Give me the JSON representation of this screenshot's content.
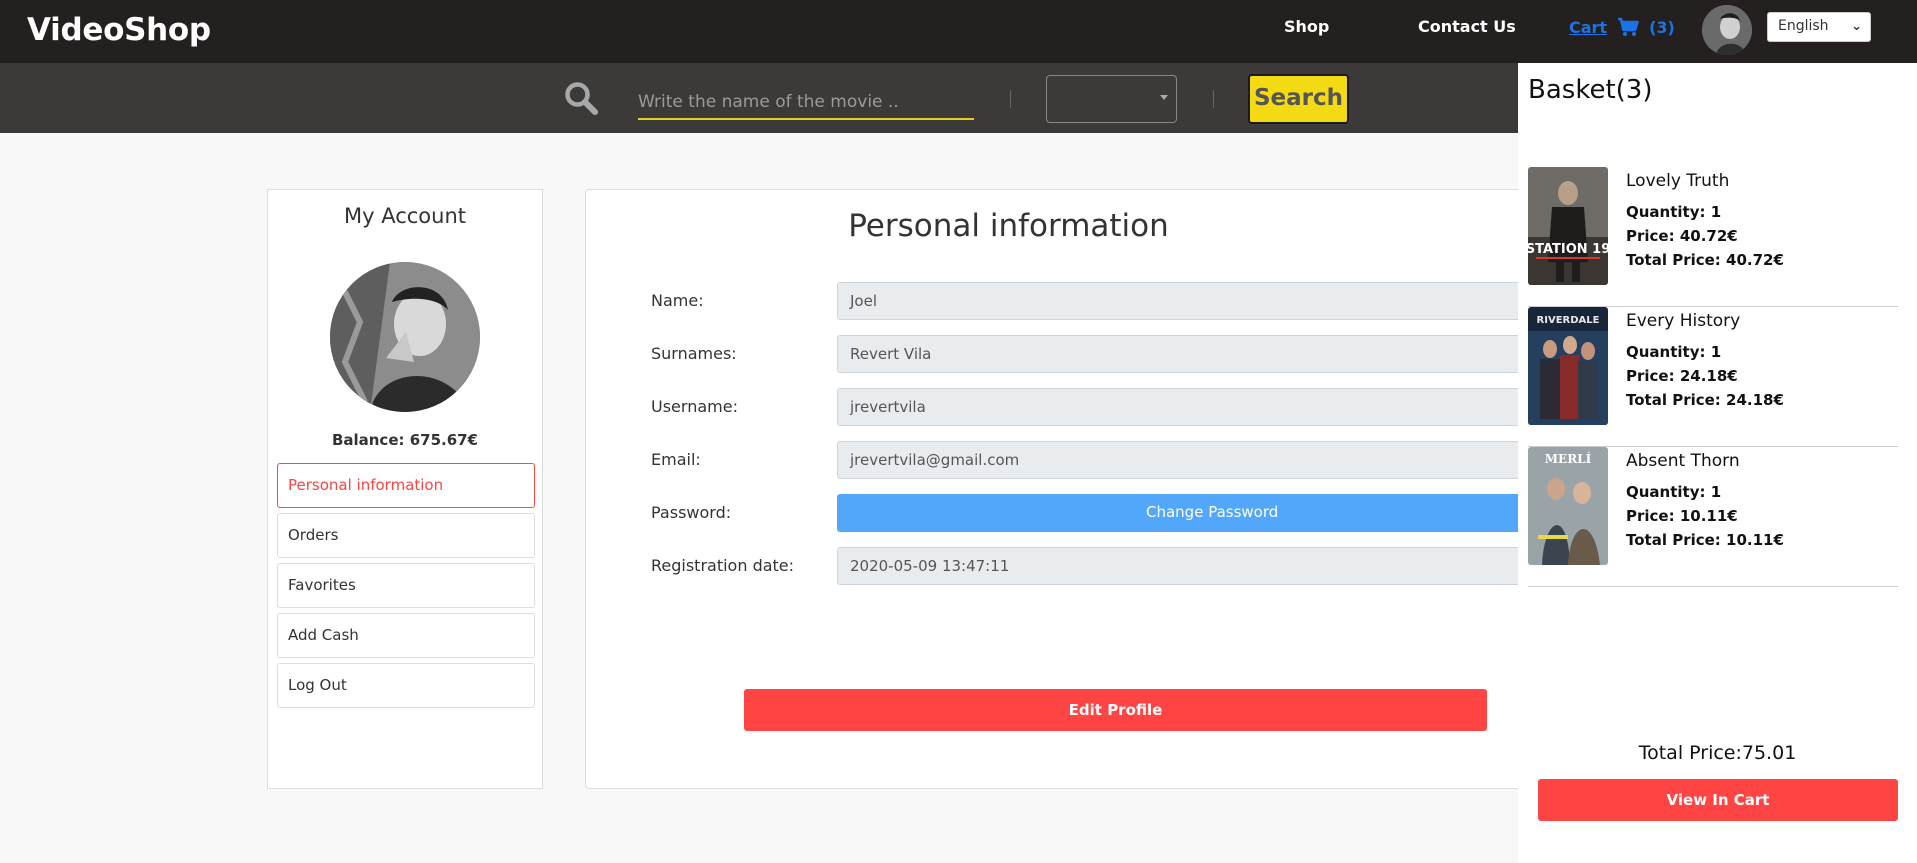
{
  "navbar": {
    "brand": "VideoShop",
    "shop_label": "Shop",
    "contact_label": "Contact Us",
    "cart_label": "Cart",
    "cart_count": "(3)",
    "language": "English",
    "icons": {
      "cart": "shopping-cart-icon",
      "avatar": "user-avatar"
    }
  },
  "search": {
    "placeholder": "Write the name of the movie ..",
    "value": "",
    "genre_selected": "",
    "button_label": "Search",
    "accent_color": "#f3da12"
  },
  "account": {
    "title": "My Account",
    "balance": "Balance: 675.67€",
    "menu": [
      {
        "label": "Personal information",
        "active": true
      },
      {
        "label": "Orders",
        "active": false
      },
      {
        "label": "Favorites",
        "active": false
      },
      {
        "label": "Add Cash",
        "active": false
      },
      {
        "label": "Log Out",
        "active": false
      }
    ]
  },
  "personal_info": {
    "title": "Personal information",
    "fields": [
      {
        "label": "Name:",
        "value": "Joel"
      },
      {
        "label": "Surnames:",
        "value": "Revert Vila"
      },
      {
        "label": "Username:",
        "value": "jrevertvila"
      },
      {
        "label": "Email:",
        "value": "jrevertvila@gmail.com"
      },
      {
        "label": "Password:",
        "button": "Change Password"
      },
      {
        "label": "Registration date:",
        "value": "2020-05-09 13:47:11"
      }
    ],
    "edit_button": "Edit Profile"
  },
  "basket": {
    "title": "Basket(3)",
    "items": [
      {
        "name": "Lovely Truth",
        "quantity": "Quantity: 1",
        "price": "Price: 40.72€",
        "total": "Total Price: 40.72€",
        "poster_text": "STATION 19"
      },
      {
        "name": "Every History",
        "quantity": "Quantity: 1",
        "price": "Price: 24.18€",
        "total": "Total Price: 24.18€",
        "poster_text": "RIVERDALE"
      },
      {
        "name": "Absent Thorn",
        "quantity": "Quantity: 1",
        "price": "Price: 10.11€",
        "total": "Total Price: 10.11€",
        "poster_text": "MERLÍ"
      }
    ],
    "total": "Total Price:75.01",
    "view_button": "View In Cart"
  },
  "colors": {
    "navbar_bg": "#24201f",
    "searchbar_bg": "#3c3a38",
    "primary_red": "#ff4444",
    "link_blue": "#1a73e8",
    "button_blue": "#52a7fb"
  }
}
